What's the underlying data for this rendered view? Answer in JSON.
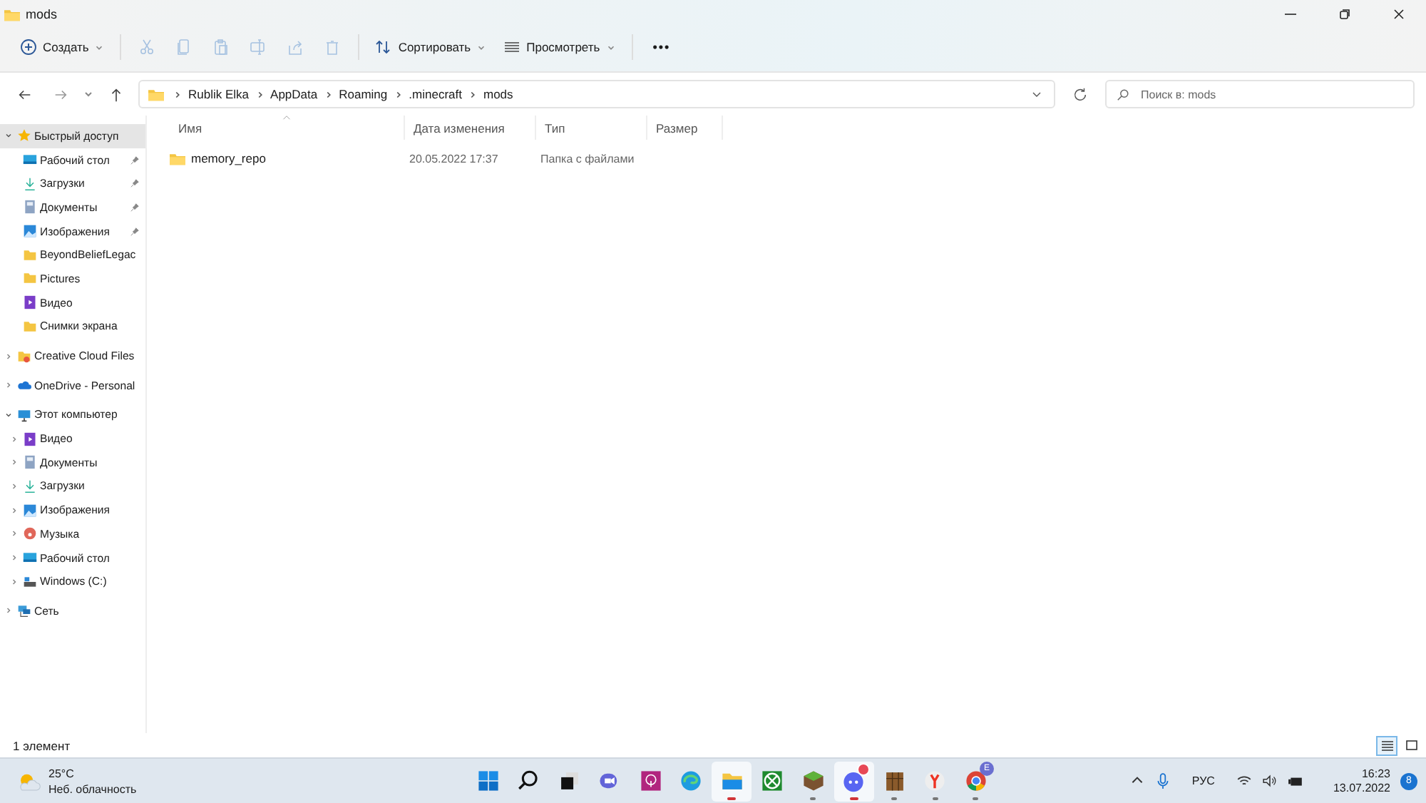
{
  "window": {
    "title": "mods"
  },
  "toolbar": [
    {
      "kind": "new",
      "label": "Создать",
      "disabled": false
    },
    {
      "kind": "cut",
      "disabled": true
    },
    {
      "kind": "copy",
      "disabled": true
    },
    {
      "kind": "paste",
      "disabled": true
    },
    {
      "kind": "rename",
      "disabled": true
    },
    {
      "kind": "share",
      "disabled": true
    },
    {
      "kind": "delete",
      "disabled": true
    },
    {
      "kind": "sort",
      "label": "Сортировать",
      "disabled": false
    },
    {
      "kind": "view",
      "label": "Просмотреть",
      "disabled": false
    },
    {
      "kind": "more",
      "label": "•••",
      "disabled": false
    }
  ],
  "address": {
    "path": [
      "Rublik Elka",
      "AppData",
      "Roaming",
      ".minecraft",
      "mods"
    ]
  },
  "search": {
    "placeholder": "Поиск в: mods"
  },
  "sidebar": {
    "items": [
      {
        "label": "Быстрый доступ",
        "kind": "star",
        "expanded": true,
        "selected": true,
        "children": [
          {
            "label": "Рабочий стол",
            "kind": "desktop",
            "pinned": true,
            "selected": false
          },
          {
            "label": "Загрузки",
            "kind": "download",
            "pinned": true,
            "selected": false
          },
          {
            "label": "Документы",
            "kind": "docs",
            "pinned": true,
            "selected": false
          },
          {
            "label": "Изображения",
            "kind": "pictures",
            "pinned": true,
            "selected": false
          },
          {
            "label": "BeyondBeliefLegac",
            "kind": "folder",
            "pinned": false,
            "selected": false
          },
          {
            "label": "Pictures",
            "kind": "folder",
            "pinned": false,
            "selected": false
          },
          {
            "label": "Видео",
            "kind": "video",
            "pinned": false,
            "selected": false
          },
          {
            "label": "Снимки экрана",
            "kind": "folder",
            "pinned": false,
            "selected": false
          }
        ]
      },
      {
        "label": "Creative Cloud Files",
        "kind": "cloudfolder",
        "expanded": false,
        "selected": false
      },
      {
        "label": "OneDrive - Personal",
        "kind": "onedrive",
        "expanded": false,
        "selected": false
      },
      {
        "label": "Этот компьютер",
        "kind": "pc",
        "expanded": true,
        "selected": false,
        "children": [
          {
            "label": "Видео",
            "kind": "video",
            "expanded": false,
            "selected": false
          },
          {
            "label": "Документы",
            "kind": "docs",
            "expanded": false,
            "selected": false
          },
          {
            "label": "Загрузки",
            "kind": "download",
            "expanded": false,
            "selected": false
          },
          {
            "label": "Изображения",
            "kind": "pictures",
            "expanded": false,
            "selected": false
          },
          {
            "label": "Музыка",
            "kind": "music",
            "expanded": false,
            "selected": false
          },
          {
            "label": "Рабочий стол",
            "kind": "desktop",
            "expanded": false,
            "selected": false
          },
          {
            "label": "Windows (C:)",
            "kind": "drive",
            "expanded": false,
            "selected": false
          }
        ]
      },
      {
        "label": "Сеть",
        "kind": "network",
        "expanded": false,
        "selected": false
      }
    ]
  },
  "table": {
    "columns": [
      "Имя",
      "Дата изменения",
      "Тип",
      "Размер"
    ],
    "rows": [
      {
        "name": "memory_repo",
        "date": "20.05.2022 17:37",
        "type": "Папка с файлами",
        "selected": false
      }
    ]
  },
  "status_bar": {
    "text": "1 элемент",
    "views": [
      {
        "kind": "details",
        "selected": true
      },
      {
        "kind": "tiles",
        "selected": false
      }
    ]
  },
  "taskbar": {
    "weather": {
      "temp": "25°C",
      "desc": "Неб. облачность"
    },
    "apps": [
      {
        "kind": "start",
        "running": false,
        "selected": false
      },
      {
        "kind": "search",
        "running": false,
        "selected": false
      },
      {
        "kind": "taskview",
        "running": false,
        "selected": false
      },
      {
        "kind": "chat",
        "running": false,
        "selected": false
      },
      {
        "kind": "podcast",
        "running": false,
        "selected": false
      },
      {
        "kind": "edge",
        "running": false,
        "selected": false
      },
      {
        "kind": "explorer",
        "running": true,
        "selected": true
      },
      {
        "kind": "xbox",
        "running": false,
        "selected": false
      },
      {
        "kind": "grass",
        "running": true,
        "selected": false
      },
      {
        "kind": "discord",
        "running": true,
        "selected": true,
        "badge_dot": true
      },
      {
        "kind": "crate",
        "running": true,
        "selected": false
      },
      {
        "kind": "yandex",
        "running": true,
        "selected": false
      },
      {
        "kind": "chrome",
        "running": true,
        "selected": false,
        "badge": "E"
      }
    ],
    "lang": "РУС",
    "time": "16:23",
    "date": "13.07.2022",
    "notifications": "8"
  }
}
